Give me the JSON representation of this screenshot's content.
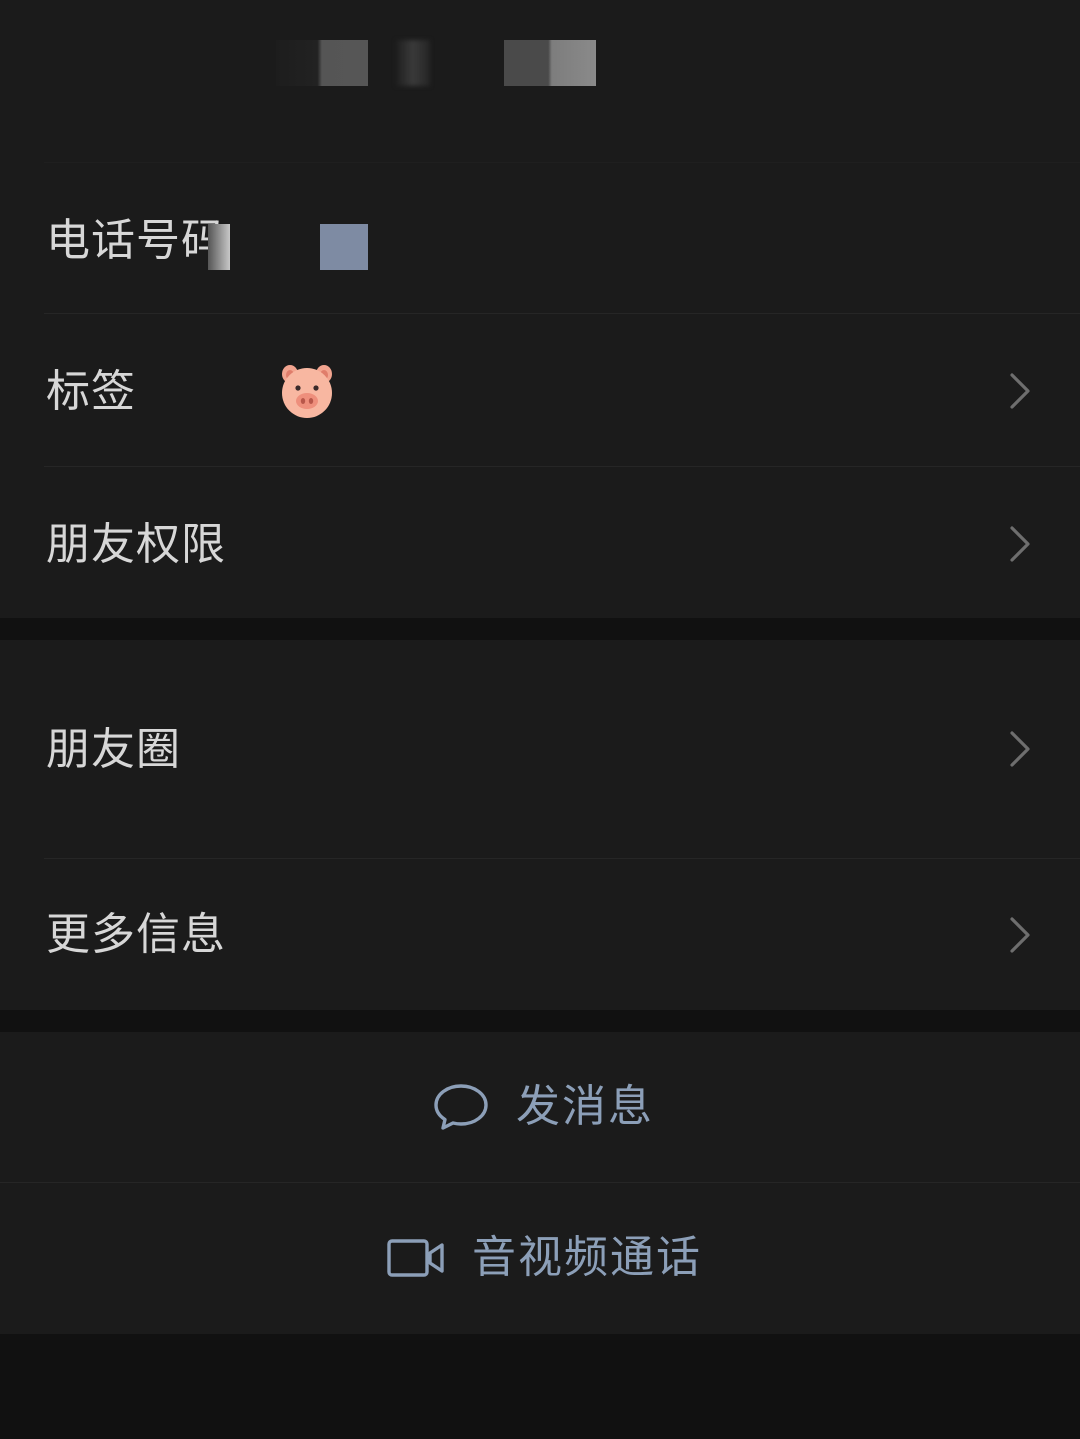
{
  "profile": {
    "obscured_name": ""
  },
  "info_rows": {
    "phone": {
      "label": "电话号码"
    },
    "tags": {
      "label": "标签",
      "tag_icon": "pig-face-icon"
    },
    "permissions": {
      "label": "朋友权限"
    }
  },
  "social_rows": {
    "moments": {
      "label": "朋友圈"
    },
    "more_info": {
      "label": "更多信息"
    }
  },
  "actions": {
    "message": {
      "label": "发消息",
      "icon": "chat-bubble-icon"
    },
    "call": {
      "label": "音视频通话",
      "icon": "video-camera-icon"
    }
  },
  "colors": {
    "background": "#111111",
    "panel": "#1b1b1b",
    "text": "#d7d7d7",
    "action_text": "#8c9fb8",
    "chevron": "#6e6e6e"
  }
}
